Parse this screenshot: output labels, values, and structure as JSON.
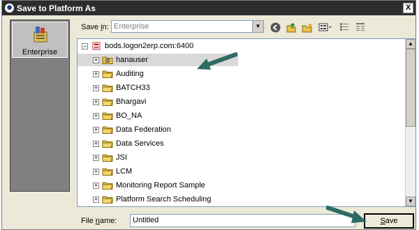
{
  "window": {
    "title": "Save to Platform As",
    "close_glyph": "X"
  },
  "places": {
    "items": [
      {
        "label": "Enterprise",
        "icon": "enterprise-icon"
      }
    ]
  },
  "save_in": {
    "label_prefix": "Save ",
    "label_accel": "i",
    "label_suffix": "n:",
    "value": "Enterprise"
  },
  "toolbar": {
    "icons": [
      "back-icon",
      "up-folder-icon",
      "new-folder-icon",
      "view-menu-icon",
      "list-view-icon",
      "details-view-icon"
    ]
  },
  "tree": {
    "root": "bods.logon2erp.com:6400",
    "items": [
      {
        "label": "hanauser",
        "icon": "user-folder-icon"
      },
      {
        "label": "Auditing",
        "icon": "folder-icon"
      },
      {
        "label": "BATCH33",
        "icon": "folder-icon"
      },
      {
        "label": "Bhargavi",
        "icon": "folder-icon"
      },
      {
        "label": "BO_NA",
        "icon": "folder-icon"
      },
      {
        "label": "Data Federation",
        "icon": "folder-icon"
      },
      {
        "label": "Data Services",
        "icon": "folder-icon"
      },
      {
        "label": "JSI",
        "icon": "folder-icon"
      },
      {
        "label": "LCM",
        "icon": "folder-icon"
      },
      {
        "label": "Monitoring Report Sample",
        "icon": "folder-icon"
      },
      {
        "label": "Platform Search Scheduling",
        "icon": "folder-icon"
      }
    ]
  },
  "file_name": {
    "label_prefix": "File ",
    "label_accel": "n",
    "label_suffix": "ame:",
    "value": "Untitled"
  },
  "save_button": {
    "label_accel": "S",
    "label_rest": "ave"
  },
  "colors": {
    "arrow": "#2e6b64",
    "title_bar": "#2d2d2d",
    "folder": "#e8c34a"
  }
}
